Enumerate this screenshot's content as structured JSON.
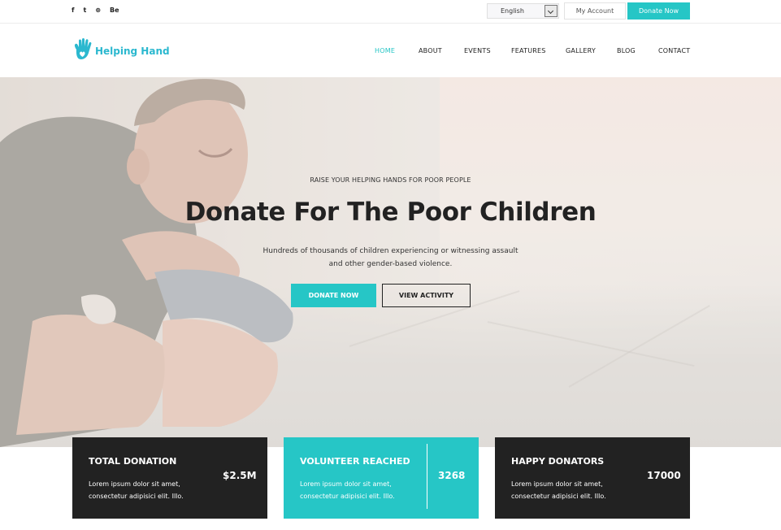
{
  "topbar": {
    "social": [
      "f",
      "t",
      "⊛",
      "Be"
    ],
    "language": "English",
    "my_account": "My Account",
    "donate_now": "Donate Now"
  },
  "brand": {
    "name": "Helping Hand",
    "accent": "#26c6c6",
    "dark": "#222222"
  },
  "nav": {
    "items": [
      "HOME",
      "ABOUT",
      "EVENTS",
      "FEATURES",
      "GALLERY",
      "BLOG",
      "CONTACT"
    ],
    "active": "HOME"
  },
  "hero": {
    "eyebrow": "RAISE YOUR HELPING HANDS FOR POOR PEOPLE",
    "headline": "Donate For The Poor Children",
    "desc_line1": "Hundreds of thousands of children experiencing or witnessing assault",
    "desc_line2": "and other gender-based violence.",
    "primary_button": "DONATE NOW",
    "secondary_button": "VIEW ACTIVITY"
  },
  "stats": [
    {
      "title": "TOTAL DONATION",
      "value": "$2.5M",
      "text1": "Lorem ipsum dolor sit amet,",
      "text2": "consectetur adipisici elit. Illo."
    },
    {
      "title": "VOLUNTEER REACHED",
      "value": "3268",
      "text1": "Lorem ipsum dolor sit amet,",
      "text2": "consectetur adipisici elit. Illo."
    },
    {
      "title": "HAPPY DONATORS",
      "value": "17000",
      "text1": "Lorem ipsum dolor sit amet,",
      "text2": "consectetur adipisici elit. Illo."
    }
  ]
}
